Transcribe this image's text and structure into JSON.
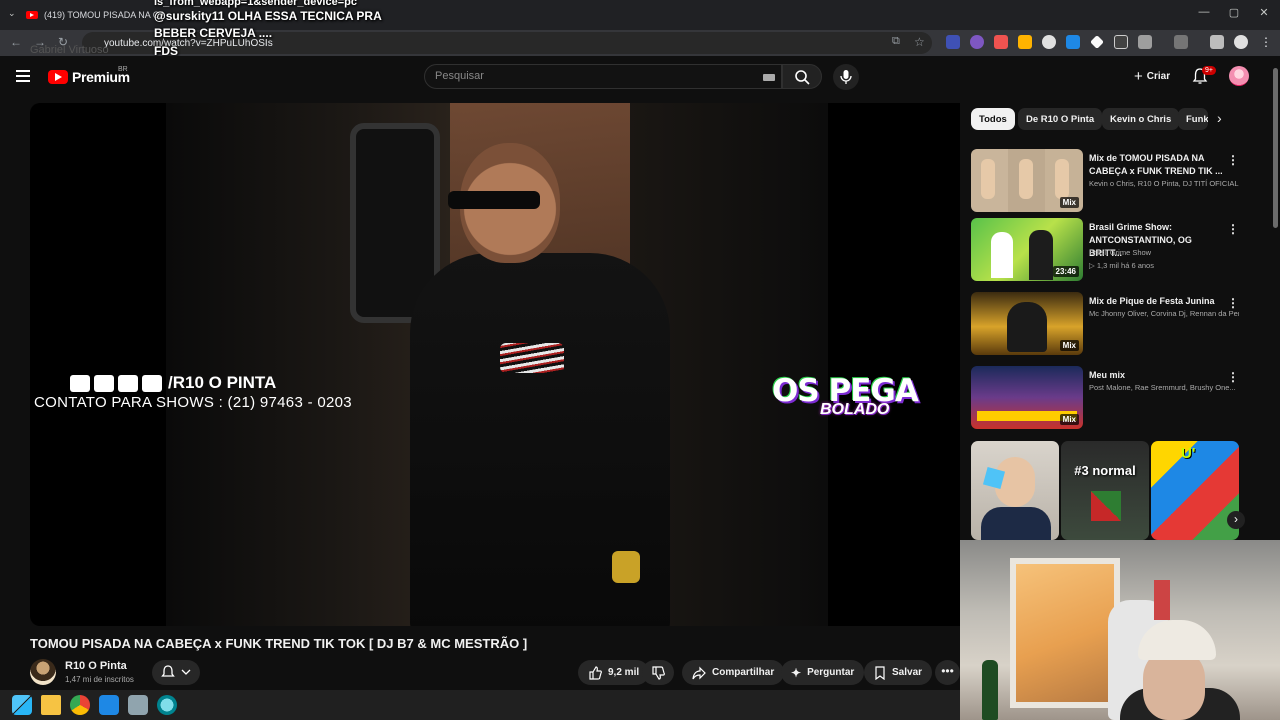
{
  "browser": {
    "tab_title": "(419) TOMOU PISADA NA CA",
    "url": "youtube.com/watch?v=ZHPuLUhOSIs",
    "url_overlay_text": "Gabriel Virtuoso"
  },
  "overlay": {
    "line1": "is_from_webapp=1&sender_device=pc",
    "line2": "@surskity11 OLHA ESSA TECNICA PRA",
    "line3": "BEBER CERVEJA ....",
    "line4": "FDS"
  },
  "header": {
    "logo_text": "Premium",
    "country_code": "BR",
    "search_placeholder": "Pesquisar",
    "create_label": "Criar",
    "notification_count": "9+"
  },
  "video": {
    "overlay_handle": "/R10 O PINTA",
    "overlay_contact": "CONTATO PARA SHOWS : (21) 97463 - 0203",
    "brand_top": "OS PEGA",
    "brand_bottom": "BOLADO",
    "title": "TOMOU PISADA NA CABEÇA x FUNK TREND TIK TOK [ DJ B7 & MC MESTRÃO ]",
    "channel_name": "R10 O Pinta",
    "subscribers": "1,47 mi de inscritos",
    "like_count": "9,2 mil",
    "share_label": "Compartilhar",
    "ask_label": "Perguntar",
    "save_label": "Salvar"
  },
  "chips": [
    "Todos",
    "De R10 O Pinta",
    "Kevin o Chris",
    "Funk"
  ],
  "recommendations": [
    {
      "title": "Mix de TOMOU PISADA NA CABEÇA x FUNK TREND TIK ...",
      "sub1": "Kevin o Chris, R10 O Pinta, DJ TITÍ OFICIAL",
      "sub2": "",
      "badge": "Mix"
    },
    {
      "title": "Brasil Grime Show: ANTCONSTANTINO, OG BRITT...",
      "sub1": "Brasil Grime Show",
      "sub2": "▷ 1,3 mil   há 6 anos",
      "badge": "23:46"
    },
    {
      "title": "Mix de Pique de Festa Junina",
      "sub1": "Mc Jhonny Oliver, Corvina Dj, Rennan da Penha",
      "sub2": "",
      "badge": "Mix"
    },
    {
      "title": "Meu mix",
      "sub1": "Post Malone, Rae Sremmurd, Brushy One...",
      "sub2": "",
      "badge": "Mix"
    }
  ],
  "shorts": [
    {
      "label": ""
    },
    {
      "label": "#3 normal"
    },
    {
      "label": "U'"
    }
  ],
  "colors": {
    "background": "#0f0f0f",
    "accent_red": "#ff0000",
    "chip_bg": "#272727",
    "brand_purple": "#7c2bd2"
  }
}
